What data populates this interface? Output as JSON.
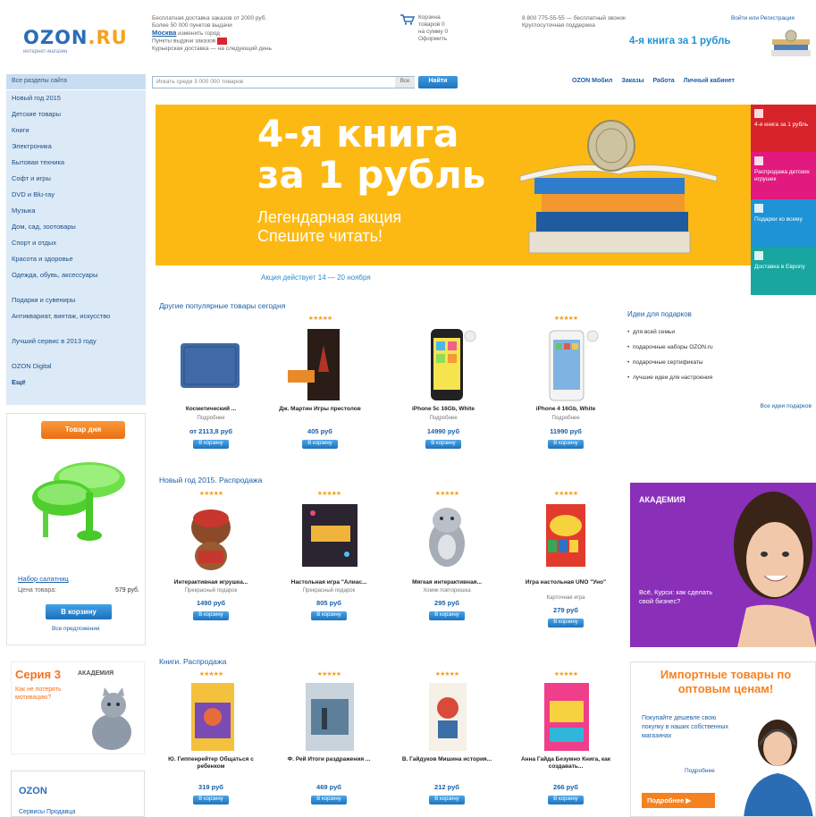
{
  "header": {
    "logo_main": "OZON",
    "logo_ru": ".RU",
    "logo_sub": "интернет-магазин",
    "info_line1": "Бесплатная доставка заказов от 2000 руб.",
    "info_line2": "Более 50 000 пунктов выдачи",
    "city": "Москва",
    "city_sub": "изменить город",
    "pickup_line": "Пункты выдачи заказов",
    "info_line3": "Курьерская доставка — на следующий день",
    "cart_lines": [
      "Корзина",
      "товаров 0",
      "на сумму 0",
      "Оформить"
    ],
    "phone_line1": "8 800 775-55-55 — бесплатный звонок",
    "phone_line2": "Круглосуточная поддержка",
    "login": "Войти или Регистрация",
    "promo": "4-я книга за 1 рубль"
  },
  "search": {
    "category_head": "Все разделы сайта",
    "placeholder": "Искать среди 3 000 000 товаров",
    "category_select": "Все",
    "button": "Найти",
    "top_links": [
      "OZON Мобил",
      "Заказы",
      "Работа",
      "Личный кабинет"
    ]
  },
  "sidebar": {
    "items": [
      "Новый год 2015",
      "Детские товары",
      "Книги",
      "Электроника",
      "Бытовая техника",
      "Софт и игры",
      "DVD и Blu-ray",
      "Музыка",
      "Дом, сад, зоотовары",
      "Спорт и отдых",
      "Красота и здоровье",
      "Одежда, обувь, аксессуары",
      "Подарки и сувениры",
      "Антиквариат, винтаж, искусство",
      "Лучший сервис в 2013 году",
      "OZON Digital",
      "Ещё"
    ],
    "promo_tab": "Товар дня",
    "promo_title": "Набор салатниц",
    "promo_price_label": "Цена товара:",
    "promo_price": "579 руб.",
    "promo_buy": "В корзину",
    "promo_more": "Все предложения",
    "seria_title": "Серия 3",
    "seria_brand": "АКАДЕМИЯ",
    "seria_text": "Как не потерять мотивацию?",
    "ozon_bottom_logo": "OZON",
    "ozon_bottom_text": "Сервисы Продавца"
  },
  "banner": {
    "line1": "4-я книга",
    "line2": "за 1 рубль",
    "sub1": "Легендарная акция",
    "sub2": "Спешите читать!",
    "strip": "Акция действует 14 — 20 ноября"
  },
  "tiles": [
    {
      "label": "4-я книга за 1 рубль",
      "color": "#d8232a"
    },
    {
      "label": "Распродажа детских игрушек",
      "color": "#e2197f"
    },
    {
      "label": "Подарки ко всему",
      "color": "#1e93d6"
    },
    {
      "label": "Доставка в Европу",
      "color": "#17a6a0"
    }
  ],
  "sections": [
    {
      "title": "Другие популярные товары сегодня",
      "products": [
        {
          "name": "Косметический ...",
          "sub": "Подробнее",
          "price": "от 2113,8 руб",
          "buy": "В корзину",
          "stars": ""
        },
        {
          "name": "Дж. Мартин Игры престолов",
          "sub": "",
          "price": "405 руб",
          "buy": "В корзину",
          "stars": "★★★★★"
        },
        {
          "name": "iPhone 5c 16Gb, White",
          "sub": "Подробнее",
          "price": "14990 руб",
          "buy": "В корзину",
          "stars": ""
        },
        {
          "name": "iPhone 4 16Gb, White",
          "sub": "Подробнее",
          "price": "11990 руб",
          "buy": "В корзину",
          "stars": "★★★★★"
        }
      ]
    },
    {
      "title": "Новый год 2015. Распродажа",
      "products": [
        {
          "name": "Интерактивная игрушка...",
          "sub": "Прекрасный подарок",
          "price": "1490 руб",
          "buy": "В корзину",
          "stars": "★★★★★"
        },
        {
          "name": "Настольная игра \"Алиас...",
          "sub": "Прекрасный подарок",
          "price": "805 руб",
          "buy": "В корзину",
          "stars": "★★★★★"
        },
        {
          "name": "Мягкая интерактивная...",
          "sub": "Хомяк повторюшка",
          "price": "295 руб",
          "buy": "В корзину",
          "stars": "★★★★★"
        },
        {
          "name": "Игра настольная UNO \"Уно\"",
          "sub": "Карточная игра",
          "price": "279 руб",
          "buy": "В корзину",
          "stars": "★★★★★"
        }
      ]
    },
    {
      "title": "Книги. Распродажа",
      "products": [
        {
          "name": "Ю. Гиппенрейтер Общаться с ребенком",
          "sub": "",
          "price": "319 руб",
          "buy": "В корзину",
          "stars": "★★★★★"
        },
        {
          "name": "Ф. Рей Итоги раздражения ...",
          "sub": "",
          "price": "469 руб",
          "buy": "В корзину",
          "stars": "★★★★★"
        },
        {
          "name": "В. Гайдуков Мишина история...",
          "sub": "",
          "price": "212 руб",
          "buy": "В корзину",
          "stars": "★★★★★"
        },
        {
          "name": "Анна Гайда Безумно Книга, как создавать...",
          "sub": "",
          "price": "266 руб",
          "buy": "В корзину",
          "stars": "★★★★★"
        }
      ]
    }
  ],
  "gifts": {
    "title": "Идеи для подарков",
    "items": [
      "для всей семьи",
      "подарочные наборы OZON.ru",
      "подарочные сертификаты",
      "лучшие идеи для настроения"
    ],
    "all": "Все идеи подарков"
  },
  "ad_purple": {
    "logo": "АКАДЕМИЯ",
    "text": "Всё, Курси: как сделать свой бизнес?"
  },
  "ad_import": {
    "title": "Импортные товары по оптовым ценам!",
    "text": "Покупайте дешевле свою покупку в наших собственных магазинах",
    "link": "Подробнее",
    "button": "Подробнее ▶"
  }
}
